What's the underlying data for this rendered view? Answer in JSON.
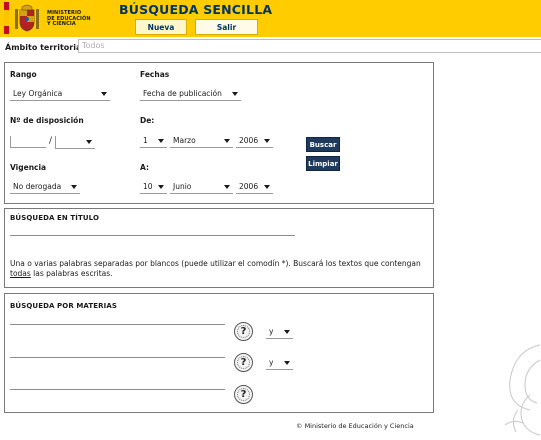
{
  "header": {
    "ministry_line1": "MINISTERIO",
    "ministry_line2": "DE EDUCACIÓN",
    "ministry_line3": "Y CIENCIA",
    "title": "BÚSQUEDA SENCILLA",
    "tabs": [
      "Nueva consulta",
      "Salir"
    ]
  },
  "ambito": {
    "label": "Ámbito territorial:",
    "value": "Todos"
  },
  "form": {
    "rango": {
      "label": "Rango",
      "value": "Ley Orgánica"
    },
    "fechas": {
      "label": "Fechas",
      "value": "Fecha de publicación"
    },
    "disposicion": {
      "label": "Nº de disposición",
      "separator": "/"
    },
    "de": {
      "label": "De:",
      "day": "1",
      "month": "Marzo",
      "year": "2006"
    },
    "a": {
      "label": "A:",
      "day": "10",
      "month": "Junio",
      "year": "2006"
    },
    "vigencia": {
      "label": "Vigencia",
      "value": "No derogada"
    },
    "buttons": {
      "buscar": "Buscar",
      "limpiar": "Limpiar"
    }
  },
  "titulo": {
    "heading": "BÚSQUEDA EN TÍTULO",
    "desc_part1": "Una o varias palabras separadas por blancos (puede utilizar el comodín *). Buscará los textos que contengan ",
    "desc_underlined": "todas",
    "desc_part2": " las palabras escritas."
  },
  "materias": {
    "heading": "BÚSQUEDA POR MATERIAS",
    "help_glyph": "?",
    "connectors": [
      "y",
      "y"
    ]
  },
  "footer": {
    "copyright": "© Ministerio de Educación y Ciencia"
  },
  "colors": {
    "header_bg": "#ffcc00",
    "title": "#003366",
    "button_bg": "#1f3a5c"
  }
}
